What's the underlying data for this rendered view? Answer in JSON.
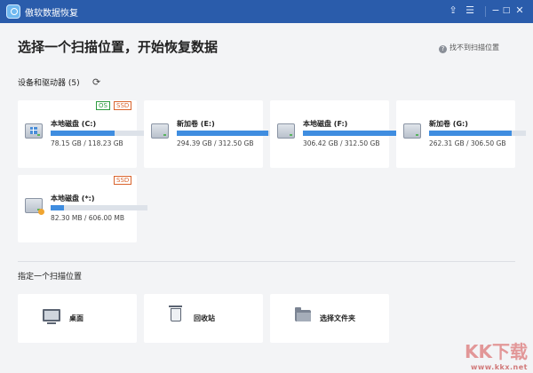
{
  "titlebar": {
    "app_title": "傲软数据恢复"
  },
  "header": {
    "title": "选择一个扫描位置，开始恢复数据",
    "help_link": "找不到扫描位置"
  },
  "devices": {
    "section_label": "设备和驱动器 (5)",
    "items": [
      {
        "name": "本地磁盘 (C:)",
        "size_text": "78.15 GB / 118.23 GB",
        "used_fraction": 0.661,
        "tags": [
          "OS",
          "SSD"
        ],
        "icon": "windows-drive-icon"
      },
      {
        "name": "新加卷 (E:)",
        "size_text": "294.39 GB / 312.50 GB",
        "used_fraction": 0.942,
        "tags": [],
        "icon": "hard-drive-icon"
      },
      {
        "name": "本地磁盘 (F:)",
        "size_text": "306.42 GB / 312.50 GB",
        "used_fraction": 0.98,
        "tags": [],
        "icon": "hard-drive-icon"
      },
      {
        "name": "新加卷 (G:)",
        "size_text": "262.31 GB / 306.50 GB",
        "used_fraction": 0.856,
        "tags": [],
        "icon": "hard-drive-icon"
      },
      {
        "name": "本地磁盘 (*:)",
        "size_text": "82.30 MB / 606.00 MB",
        "used_fraction": 0.136,
        "tags": [
          "SSD"
        ],
        "icon": "warning-drive-icon"
      }
    ]
  },
  "locations": {
    "section_label": "指定一个扫描位置",
    "items": [
      {
        "label": "桌面",
        "icon": "desktop-icon"
      },
      {
        "label": "回收站",
        "icon": "recycle-bin-icon"
      },
      {
        "label": "选择文件夹",
        "icon": "folder-icon"
      }
    ]
  },
  "watermark": {
    "text": "KK下载",
    "url": "www.kkx.net"
  },
  "colors": {
    "titlebar": "#2a5cab",
    "progress_fill": "#3f8de0",
    "os_tag": "#2d9b3e",
    "ssd_tag": "#d9632c"
  }
}
